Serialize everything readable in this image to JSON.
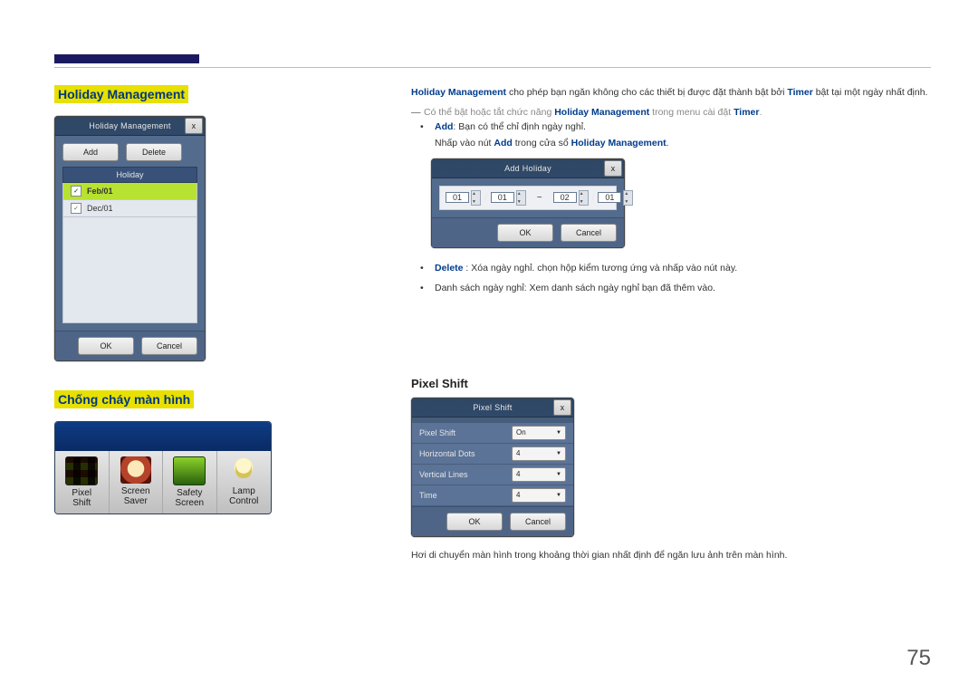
{
  "page_number": "75",
  "left": {
    "holiday_heading": "Holiday Management",
    "burn_heading": "Chống cháy màn hình",
    "holiday_dialog": {
      "title": "Holiday Management",
      "add_label": "Add",
      "delete_label": "Delete",
      "col_header": "Holiday",
      "rows": [
        {
          "date": "Feb/01",
          "selected": true,
          "checked": true
        },
        {
          "date": "Dec/01",
          "selected": false,
          "checked": true
        }
      ],
      "ok": "OK",
      "cancel": "Cancel"
    },
    "burnbar": {
      "items": [
        {
          "line1": "Pixel",
          "line2": "Shift"
        },
        {
          "line1": "Screen",
          "line2": "Saver"
        },
        {
          "line1": "Safety",
          "line2": "Screen"
        },
        {
          "line1": "Lamp",
          "line2": "Control"
        }
      ]
    }
  },
  "right": {
    "intro_prefix": "Holiday Management",
    "intro_rest": " cho phép bạn ngăn không cho các thiết bị được đặt thành bật bởi ",
    "intro_timer": "Timer",
    "intro_tail": " bật tại một ngày nhất định.",
    "dash_line_pre": "Có thể bật hoặc tắt chức năng ",
    "dash_line_hm": "Holiday Management",
    "dash_line_mid": " trong menu cài đặt ",
    "dash_line_timer": "Timer",
    "dash_line_end": ".",
    "bullet_add_label": "Add",
    "bullet_add_text": ": Bạn có thể chỉ định ngày nghỉ.",
    "bullet_add_sub_pre": "Nhấp vào nút ",
    "bullet_add_sub_add": "Add",
    "bullet_add_sub_mid": " trong cửa sổ ",
    "bullet_add_sub_hm": "Holiday Management",
    "bullet_add_sub_end": ".",
    "add_dialog": {
      "title": "Add Holiday",
      "from_month": "01",
      "from_day": "01",
      "to_month": "02",
      "to_day": "01",
      "ok": "OK",
      "cancel": "Cancel"
    },
    "bullet_delete_label": "Delete",
    "bullet_delete_text": " : Xóa ngày nghỉ. chọn hộp kiểm tương ứng và nhấp vào nút này.",
    "bullet_list_text": "Danh sách ngày nghỉ: Xem danh sách ngày nghỉ bạn đã thêm vào.",
    "pixel_heading": "Pixel Shift",
    "pixel_dialog": {
      "title": "Pixel Shift",
      "rows": [
        {
          "label": "Pixel Shift",
          "value": "On"
        },
        {
          "label": "Horizontal Dots",
          "value": "4"
        },
        {
          "label": "Vertical Lines",
          "value": "4"
        },
        {
          "label": "Time",
          "value": "4"
        }
      ],
      "ok": "OK",
      "cancel": "Cancel"
    },
    "pixel_text": "Hơi di chuyển màn hình trong khoảng thời gian nhất định để ngăn lưu ảnh trên màn hình."
  }
}
